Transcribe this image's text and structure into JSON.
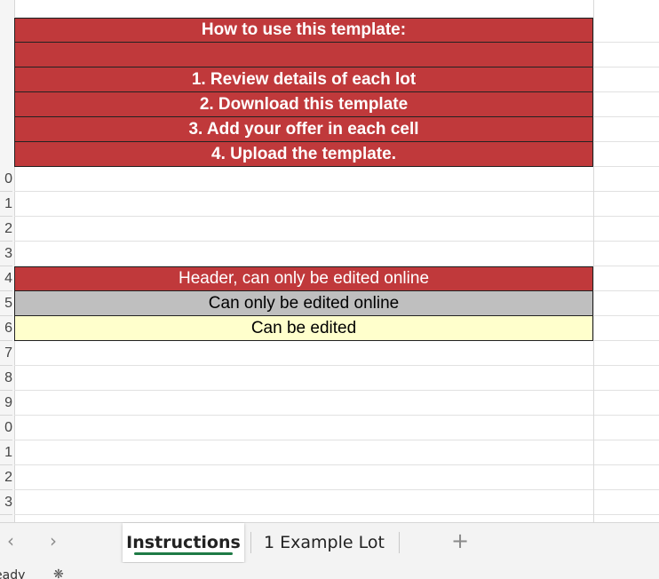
{
  "instructions": {
    "title": "How to use this template:",
    "steps": [
      "1. Review details of each lot",
      "2. Download this template",
      "3. Add your offer in each cell",
      "4. Upload the template."
    ]
  },
  "legend": {
    "header_label": "Header, can only be edited online",
    "readonly_label": "Can only be edited online",
    "editable_label": "Can be edited"
  },
  "colors": {
    "header_red": "#c0393b",
    "readonly_grey": "#bfbfbf",
    "editable_yellow": "#ffffcc",
    "active_tab_accent": "#1e7a45"
  },
  "row_numbers_partial": [
    "0",
    "1",
    "2",
    "3",
    "4",
    "5",
    "6",
    "7",
    "8",
    "9",
    "0",
    "1",
    "2",
    "3"
  ],
  "tabs": {
    "prev_icon": "chevron-left-icon",
    "next_icon": "chevron-right-icon",
    "items": [
      {
        "label": "Instructions",
        "active": true
      },
      {
        "label": "1 Example Lot",
        "active": false
      }
    ],
    "add_label": "+"
  },
  "status": {
    "text": "eady",
    "icon": "accessibility-icon"
  }
}
